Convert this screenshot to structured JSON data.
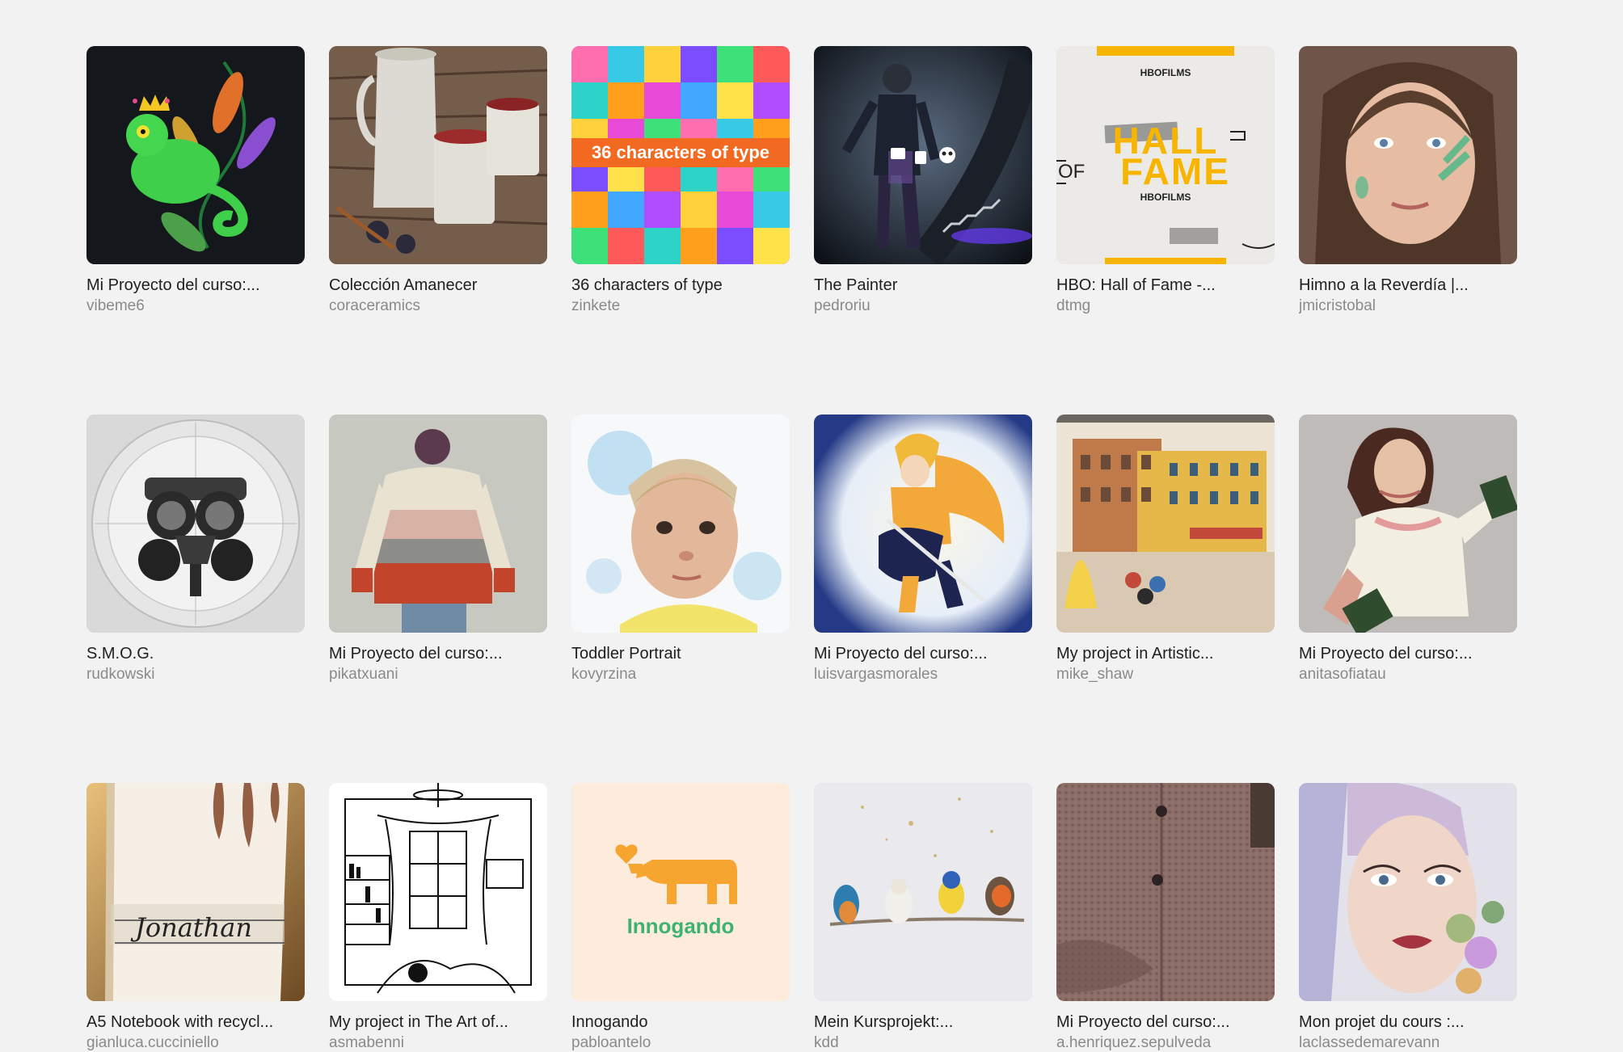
{
  "projects": [
    {
      "title": "Mi Proyecto del curso:...",
      "author": "vibeme6"
    },
    {
      "title": "Colección Amanecer",
      "author": "coraceramics"
    },
    {
      "title": "36 characters of type",
      "author": "zinkete",
      "thumb_banner": "36 characters of type"
    },
    {
      "title": "The Painter",
      "author": "pedroriu"
    },
    {
      "title": "HBO: Hall of Fame -...",
      "author": "dtmg",
      "thumb_text": {
        "brand": "HBOFILMS",
        "headline_1": "HALL",
        "headline_2": "FAME",
        "side": "OF"
      }
    },
    {
      "title": "Himno a la Reverdía |...",
      "author": "jmicristobal"
    },
    {
      "title": "S.M.O.G.",
      "author": "rudkowski"
    },
    {
      "title": "Mi Proyecto del curso:...",
      "author": "pikatxuani"
    },
    {
      "title": "Toddler Portrait",
      "author": "kovyrzina"
    },
    {
      "title": "Mi Proyecto del curso:...",
      "author": "luisvargasmorales"
    },
    {
      "title": "My project in Artistic...",
      "author": "mike_shaw"
    },
    {
      "title": "Mi Proyecto del curso:...",
      "author": "anitasofiatau"
    },
    {
      "title": "A5 Notebook with recycl...",
      "author": "gianluca.cucciniello",
      "thumb_text": "Jonathan"
    },
    {
      "title": "My project in The Art of...",
      "author": "asmabenni"
    },
    {
      "title": "Innogando",
      "author": "pabloantelo",
      "thumb_text": "Innogando"
    },
    {
      "title": "Mein Kursprojekt:...",
      "author": "kdd"
    },
    {
      "title": "Mi Proyecto del curso:...",
      "author": "a.henriquez.sepulveda"
    },
    {
      "title": "Mon projet du cours :...",
      "author": "laclassedemarevann"
    }
  ],
  "colors": {
    "background": "#f2f2f2",
    "title_text": "#1f1f1f",
    "author_text": "#8a8a8a",
    "innogando_orange": "#f6a531",
    "innogando_green": "#3cb371",
    "hbo_yellow": "#f7b500",
    "type_banner": "#f26a21"
  }
}
